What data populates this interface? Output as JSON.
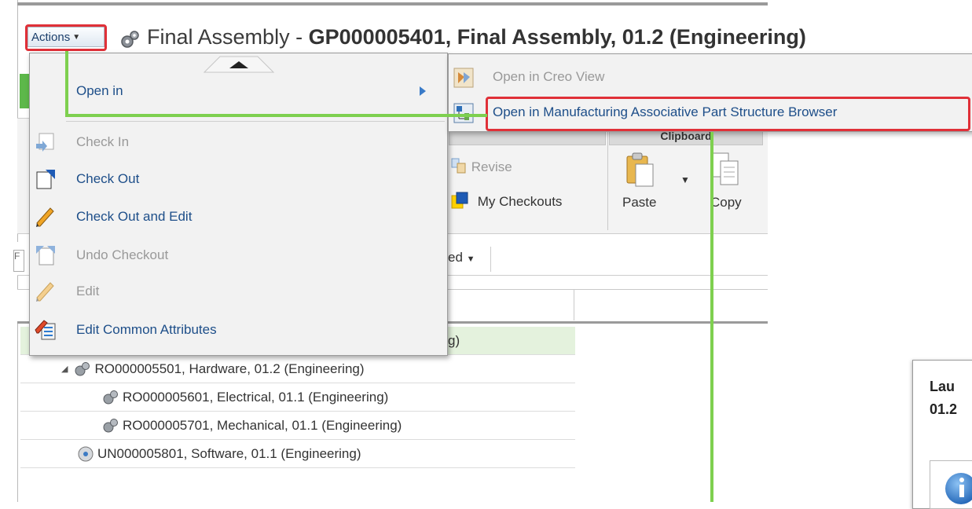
{
  "header": {
    "actions_label": "Actions",
    "title_prefix": "Final Assembly - ",
    "title_bold": "GP000005401, Final Assembly, 01.2 (Engineering)"
  },
  "ribbon": {
    "group1_header": "",
    "group2_header": "Clipboard",
    "revise_label": "Revise",
    "my_checkouts_label": "My Checkouts",
    "paste_label": "Paste",
    "copy_label": "Copy",
    "dropdown_partial": "ed"
  },
  "menu": {
    "items": [
      {
        "label": "Open in",
        "enabled": true
      },
      {
        "label": "Check In",
        "enabled": false
      },
      {
        "label": "Check Out",
        "enabled": true
      },
      {
        "label": "Check Out and Edit",
        "enabled": true
      },
      {
        "label": "Undo Checkout",
        "enabled": false
      },
      {
        "label": "Edit",
        "enabled": false
      },
      {
        "label": "Edit Common Attributes",
        "enabled": true
      }
    ]
  },
  "submenu": {
    "items": [
      {
        "label": "Open in Creo View",
        "enabled": false
      },
      {
        "label": "Open in Manufacturing Associative Part Structure Browser",
        "enabled": true
      }
    ]
  },
  "tree": {
    "rows": [
      {
        "text": "g)",
        "indent": 0,
        "selected": true
      },
      {
        "text": "RO000005501, Hardware, 01.2 (Engineering)",
        "indent": 1,
        "expanded": true
      },
      {
        "text": "RO000005601, Electrical, 01.1 (Engineering)",
        "indent": 2
      },
      {
        "text": "RO000005701, Mechanical, 01.1 (Engineering)",
        "indent": 2
      },
      {
        "text": "UN000005801, Software, 01.1 (Engineering)",
        "indent": 1
      }
    ]
  },
  "launch_dialog": {
    "line1": "Lau",
    "line2": "01.2"
  },
  "colors": {
    "callout_green": "#7ed04f",
    "highlight_red": "#e03038",
    "link_blue": "#1d4e89"
  }
}
